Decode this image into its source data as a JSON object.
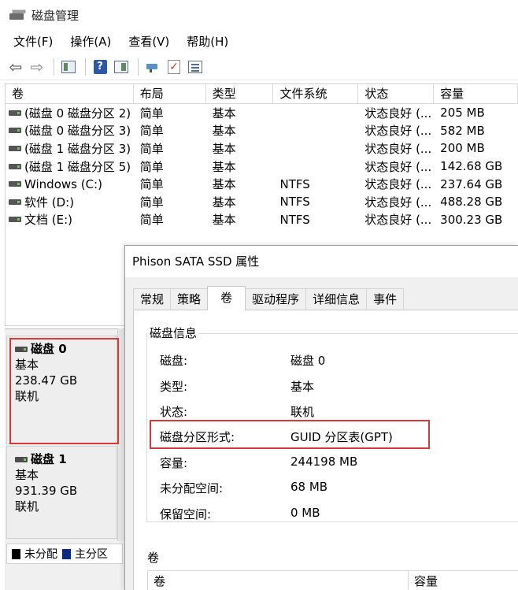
{
  "window": {
    "title": "磁盘管理"
  },
  "menu": [
    "文件(F)",
    "操作(A)",
    "查看(V)",
    "帮助(H)"
  ],
  "toolbar": {
    "icons": [
      "back-arrow-icon",
      "forward-arrow-icon",
      "show-hide-console-tree-icon",
      "help-icon",
      "action-pane-icon",
      "connect-icon",
      "check-icon",
      "properties-list-icon"
    ]
  },
  "volume_table": {
    "headers": [
      "卷",
      "布局",
      "类型",
      "文件系统",
      "状态",
      "容量"
    ],
    "rows": [
      {
        "name": "(磁盘 0 磁盘分区 2)",
        "layout": "简单",
        "type": "基本",
        "fs": "",
        "status": "状态良好 (...",
        "capacity": "205 MB"
      },
      {
        "name": "(磁盘 0 磁盘分区 3)",
        "layout": "简单",
        "type": "基本",
        "fs": "",
        "status": "状态良好 (...",
        "capacity": "582 MB"
      },
      {
        "name": "(磁盘 1 磁盘分区 3)",
        "layout": "简单",
        "type": "基本",
        "fs": "",
        "status": "状态良好 (...",
        "capacity": "200 MB"
      },
      {
        "name": "(磁盘 1 磁盘分区 5)",
        "layout": "简单",
        "type": "基本",
        "fs": "",
        "status": "状态良好 (...",
        "capacity": "142.68 GB"
      },
      {
        "name": "Windows (C:)",
        "layout": "简单",
        "type": "基本",
        "fs": "NTFS",
        "status": "状态良好 (...",
        "capacity": "237.64 GB"
      },
      {
        "name": "软件 (D:)",
        "layout": "简单",
        "type": "基本",
        "fs": "NTFS",
        "status": "状态良好 (...",
        "capacity": "488.28 GB"
      },
      {
        "name": "文档 (E:)",
        "layout": "简单",
        "type": "基本",
        "fs": "NTFS",
        "status": "状态良好 (...",
        "capacity": "300.23 GB"
      }
    ]
  },
  "disks": [
    {
      "name": "磁盘 0",
      "type": "基本",
      "size": "238.47 GB",
      "status": "联机"
    },
    {
      "name": "磁盘 1",
      "type": "基本",
      "size": "931.39 GB",
      "status": "联机"
    }
  ],
  "legend": {
    "unallocated": "未分配",
    "primary": "主分区"
  },
  "dialog": {
    "title": "Phison SATA SSD 属性",
    "tabs": [
      "常规",
      "策略",
      "卷",
      "驱动程序",
      "详细信息",
      "事件"
    ],
    "active_tab": "卷",
    "group_title": "磁盘信息",
    "props": [
      {
        "key": "磁盘:",
        "value": "磁盘 0"
      },
      {
        "key": "类型:",
        "value": "基本"
      },
      {
        "key": "状态:",
        "value": "联机"
      },
      {
        "key": "磁盘分区形式:",
        "value": "GUID 分区表(GPT)"
      },
      {
        "key": "容量:",
        "value": "244198 MB"
      },
      {
        "key": "未分配空间:",
        "value": "68 MB"
      },
      {
        "key": "保留空间:",
        "value": "0 MB"
      }
    ],
    "volumes_label": "卷",
    "volume_columns": [
      "卷",
      "容量"
    ]
  },
  "highlight_color": "#d83a3a"
}
